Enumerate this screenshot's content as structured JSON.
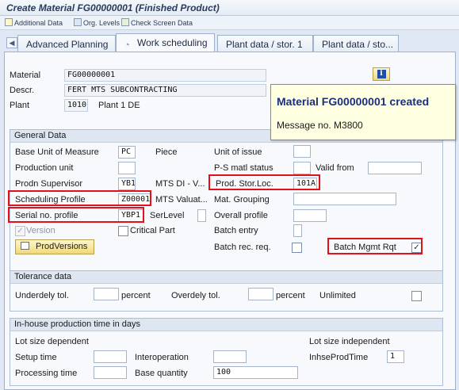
{
  "window": {
    "title": "Create Material FG00000001 (Finished Product)"
  },
  "toolbar": {
    "additional_data": "Additional Data",
    "org_levels": "Org. Levels",
    "check_screen_data": "Check Screen Data"
  },
  "tabs": [
    {
      "label": "Advanced Planning"
    },
    {
      "label": "Work scheduling"
    },
    {
      "label": "Plant data / stor. 1"
    },
    {
      "label": "Plant data / sto..."
    }
  ],
  "header": {
    "material_label": "Material",
    "material_value": "FG00000001",
    "descr_label": "Descr.",
    "descr_value": "FERT MTS SUBCONTRACTING",
    "plant_label": "Plant",
    "plant_value": "1010",
    "plant_name": "Plant 1 DE"
  },
  "message": {
    "title": "Material FG00000001 created",
    "text": "Message no. M3800"
  },
  "general": {
    "title": "General Data",
    "base_uom_label": "Base Unit of Measure",
    "base_uom_value": "PC",
    "base_uom_text": "Piece",
    "unit_issue_label": "Unit of issue",
    "unit_issue_value": "",
    "prod_unit_label": "Production unit",
    "prod_unit_value": "",
    "ps_status_label": "P-S matl status",
    "ps_status_value": "",
    "valid_from_label": "Valid from",
    "valid_from_value": "",
    "prodn_sup_label": "Prodn Supervisor",
    "prodn_sup_value": "YB1",
    "prodn_sup_text": "MTS DI - V...",
    "prod_stor_label": "Prod. Stor.Loc.",
    "prod_stor_value": "101A",
    "sched_prof_label": "Scheduling Profile",
    "sched_prof_value": "Z00001",
    "sched_prof_text": "MTS Valuat...",
    "mat_group_label": "Mat. Grouping",
    "mat_group_value": "",
    "serial_label": "Serial no. profile",
    "serial_value": "YBP1",
    "serlevel_label": "SerLevel",
    "serlevel_value": "",
    "overall_label": "Overall profile",
    "overall_value": "",
    "version_label": "Version",
    "version_checked": "✓",
    "critical_label": "Critical Part",
    "critical_checked": "",
    "batch_entry_label": "Batch entry",
    "batch_entry_value": "",
    "prodversions_label": "ProdVersions",
    "batch_rec_label": "Batch rec. req.",
    "batch_rec_checked": "",
    "batch_mgmt_label": "Batch Mgmt Rqt",
    "batch_mgmt_checked": "✓"
  },
  "tolerance": {
    "title": "Tolerance data",
    "under_label": "Underdely tol.",
    "under_value": "",
    "under_unit": "percent",
    "over_label": "Overdely tol.",
    "over_value": "",
    "over_unit": "percent",
    "unlimited_label": "Unlimited",
    "unlimited_checked": ""
  },
  "inhouse": {
    "title": "In-house production time in days",
    "lot_dep_label": "Lot size dependent",
    "lot_indep_label": "Lot size independent",
    "setup_label": "Setup time",
    "setup_value": "",
    "interop_label": "Interoperation",
    "interop_value": "",
    "inhse_label": "InhseProdTime",
    "inhse_value": "1",
    "proc_label": "Processing time",
    "proc_value": "",
    "base_qty_label": "Base quantity",
    "base_qty_value": "100"
  },
  "colors": {
    "highlight": "#e3101a",
    "message_title": "#1b2f7a"
  }
}
